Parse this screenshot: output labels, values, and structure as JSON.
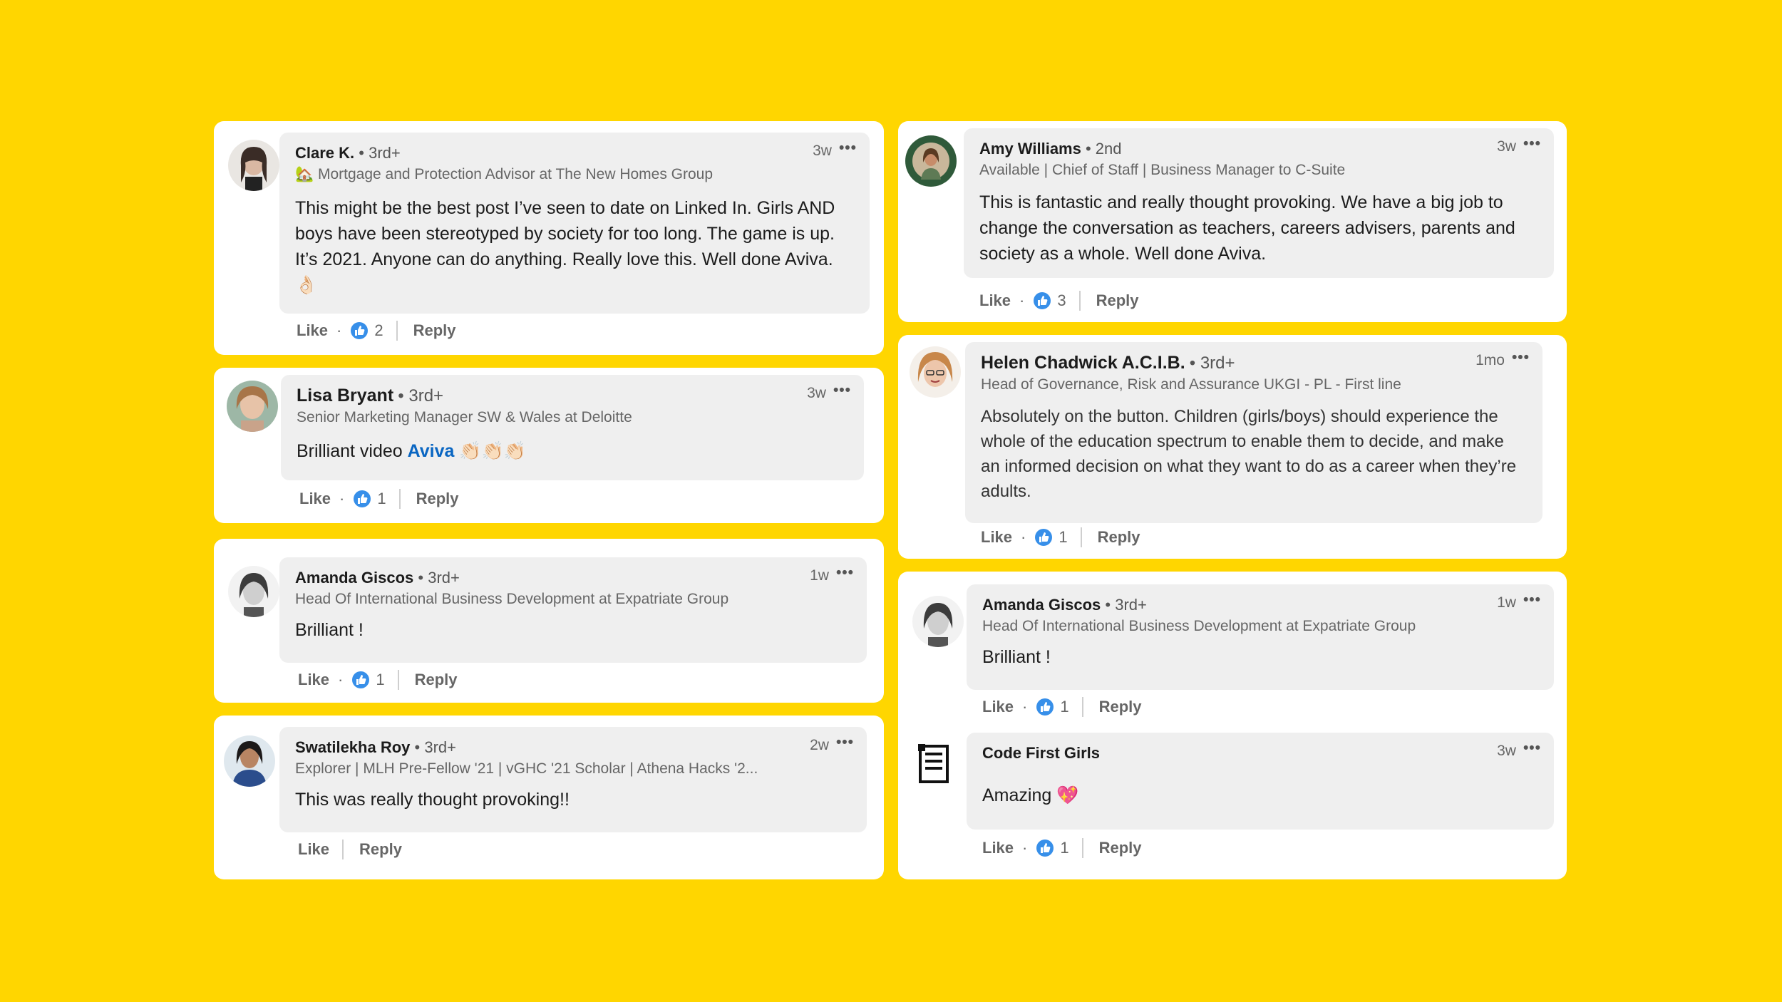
{
  "comments": [
    {
      "name": "Clare K.",
      "degree": "• 3rd+",
      "time": "3w",
      "headline": "🏡 Mortgage and Protection Advisor at The New Homes Group",
      "text": "This might be the best post I’ve seen to date on Linked In. Girls AND boys have been stereotyped by society for too long. The game is up. It’s 2021. Anyone can do anything. Really love this. Well done Aviva. 👌🏻",
      "like": "Like",
      "reactions": "2",
      "reply": "Reply"
    },
    {
      "name": "Lisa Bryant",
      "degree": "• 3rd+",
      "time": "3w",
      "headline": "Senior Marketing Manager SW & Wales at Deloitte",
      "text_prefix": "Brilliant video ",
      "text_link": "Aviva",
      "text_suffix": " 👏🏻👏🏻👏🏻",
      "like": "Like",
      "reactions": "1",
      "reply": "Reply"
    },
    {
      "name": "Amanda Giscos",
      "degree": "• 3rd+",
      "time": "1w",
      "headline": "Head Of International Business Development at Expatriate Group",
      "text": "Brilliant !",
      "like": "Like",
      "reactions": "1",
      "reply": "Reply"
    },
    {
      "name": "Swatilekha Roy",
      "degree": "• 3rd+",
      "time": "2w",
      "headline": "Explorer | MLH Pre-Fellow '21 | vGHC '21 Scholar | Athena Hacks '2...",
      "text": "This was really thought provoking!!",
      "like": "Like",
      "reply": "Reply"
    },
    {
      "name": "Amy Williams",
      "degree": "• 2nd",
      "time": "3w",
      "headline": "Available | Chief of Staff | Business Manager to C-Suite",
      "text": "This is fantastic and really thought provoking. We have a big job to change the conversation as teachers, careers advisers, parents and society as a whole. Well done Aviva.",
      "like": "Like",
      "reactions": "3",
      "reply": "Reply"
    },
    {
      "name": "Helen Chadwick A.C.I.B.",
      "degree": "• 3rd+",
      "time": "1mo",
      "headline": "Head of Governance, Risk and Assurance UKGI - PL - First line",
      "text": "Absolutely on the button. Children (girls/boys) should experience the whole of the education spectrum to enable them to decide, and make an informed decision on what they want to do as a career when they’re adults.",
      "like": "Like",
      "reactions": "1",
      "reply": "Reply"
    },
    {
      "name": "Amanda Giscos",
      "degree": "• 3rd+",
      "time": "1w",
      "headline": "Head Of International Business Development at Expatriate Group",
      "text": "Brilliant !",
      "like": "Like",
      "reactions": "1",
      "reply": "Reply"
    },
    {
      "name": "Code First Girls",
      "time": "3w",
      "text": "Amazing 💖",
      "like": "Like",
      "reactions": "1",
      "reply": "Reply"
    }
  ],
  "more_label": "•••",
  "dot": "·"
}
